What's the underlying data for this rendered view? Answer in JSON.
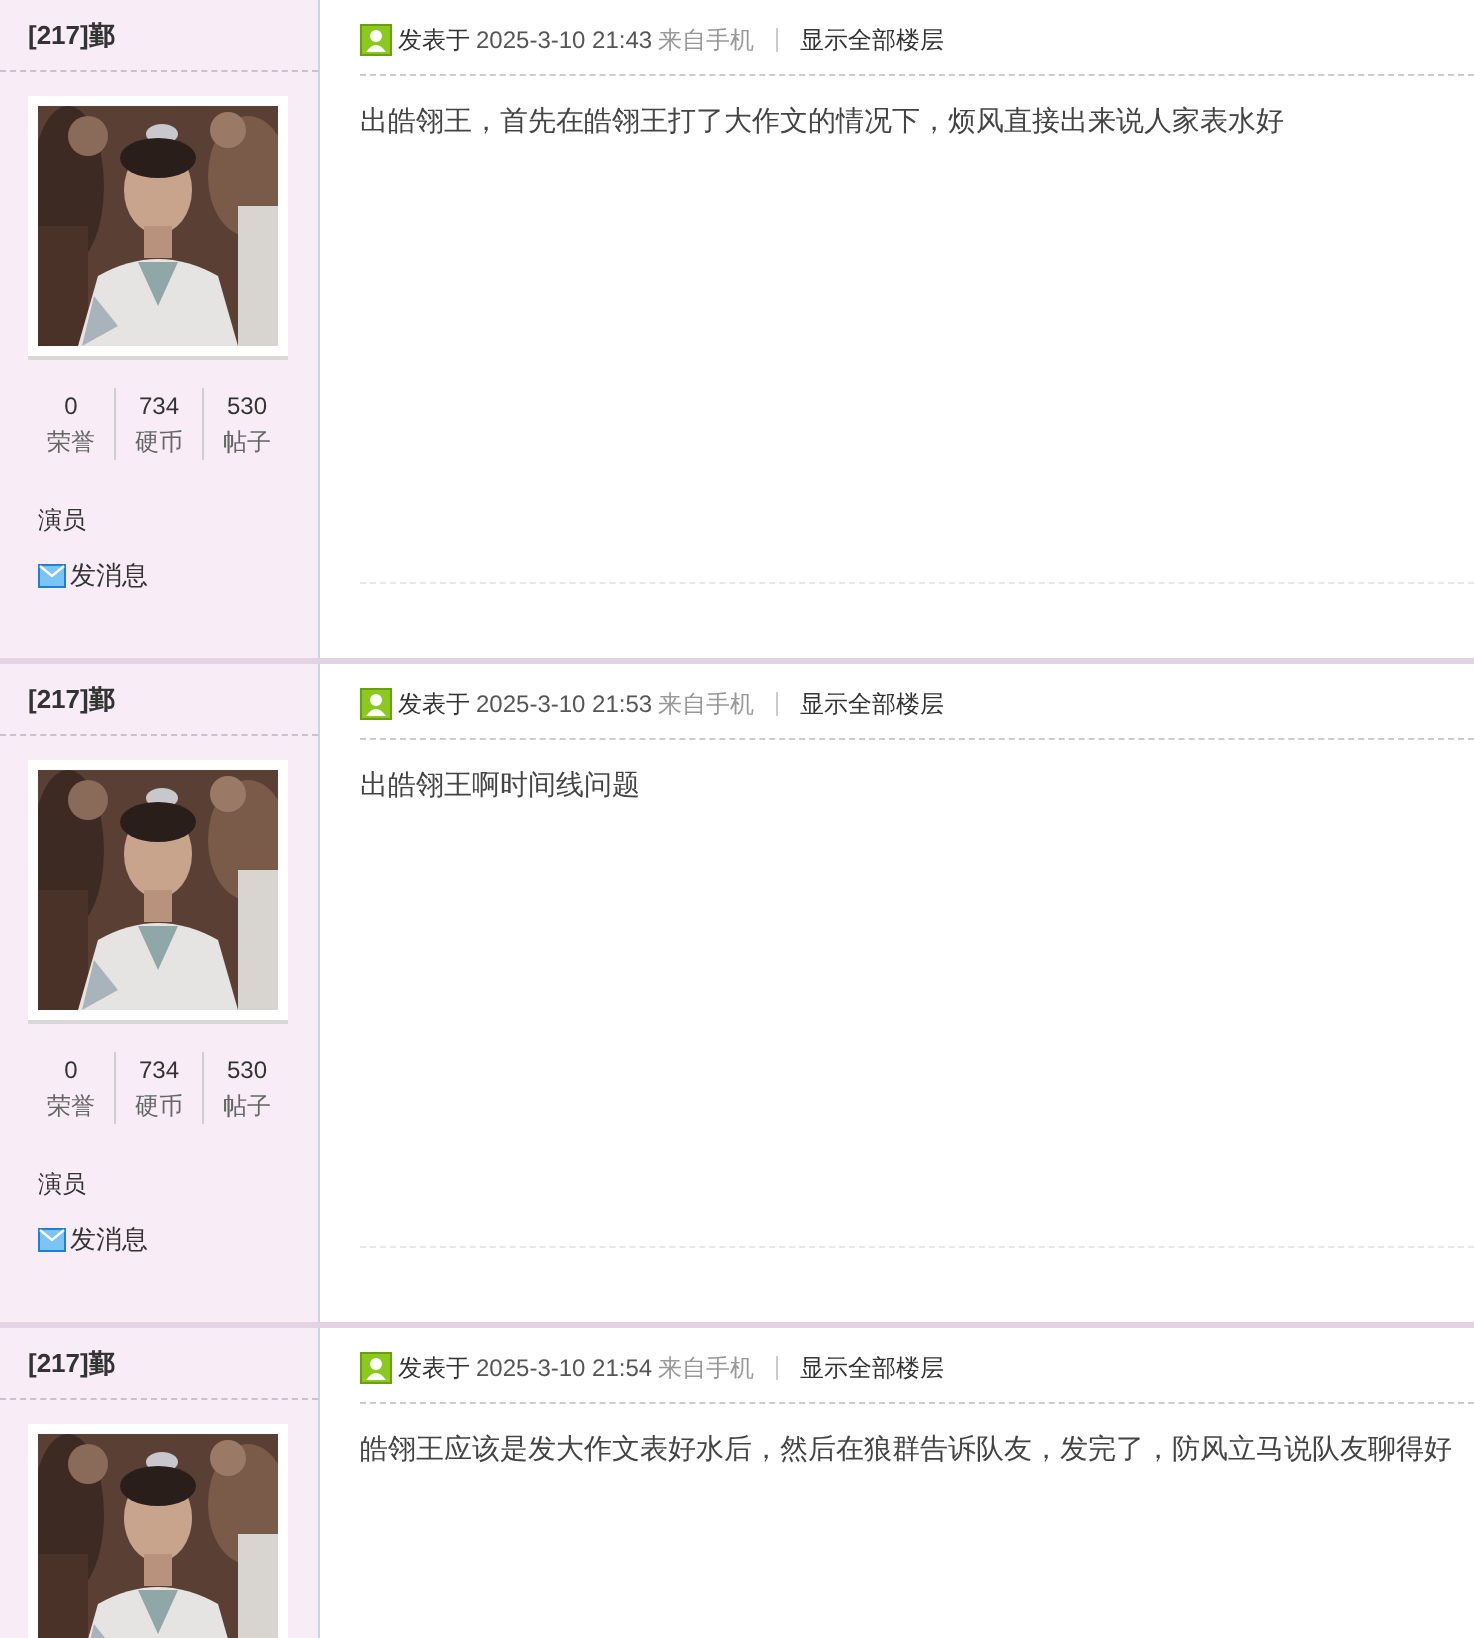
{
  "posts": [
    {
      "author": "[217]鄞",
      "stats": [
        {
          "value": "0",
          "label": "荣誉"
        },
        {
          "value": "734",
          "label": "硬币"
        },
        {
          "value": "530",
          "label": "帖子"
        }
      ],
      "role": "演员",
      "message_link": "发消息",
      "posted_label": "发表于",
      "time": "2025-3-10 21:43",
      "source": "来自手机",
      "show_all": "显示全部楼层",
      "content": "出皓翎王，首先在皓翎王打了大作文的情况下，烦风直接出来说人家表水好"
    },
    {
      "author": "[217]鄞",
      "stats": [
        {
          "value": "0",
          "label": "荣誉"
        },
        {
          "value": "734",
          "label": "硬币"
        },
        {
          "value": "530",
          "label": "帖子"
        }
      ],
      "role": "演员",
      "message_link": "发消息",
      "posted_label": "发表于",
      "time": "2025-3-10 21:53",
      "source": "来自手机",
      "show_all": "显示全部楼层",
      "content": "出皓翎王啊时间线问题"
    },
    {
      "author": "[217]鄞",
      "posted_label": "发表于",
      "time": "2025-3-10 21:54",
      "source": "来自手机",
      "show_all": "显示全部楼层",
      "content": "皓翎王应该是发大作文表好水后，然后在狼群告诉队友，发完了，防风立马说队友聊得好"
    }
  ]
}
